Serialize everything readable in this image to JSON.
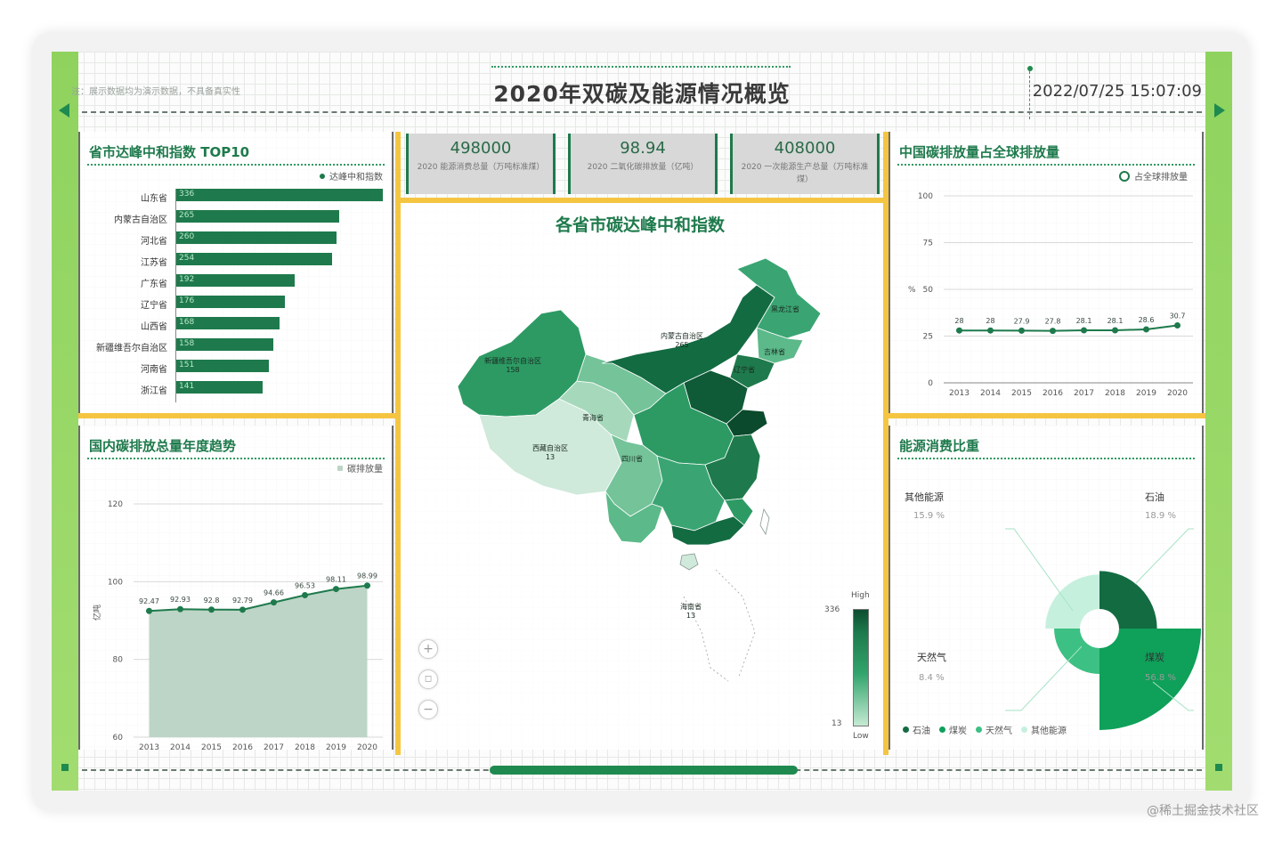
{
  "header": {
    "note": "注：展示数据均为演示数据，不具备真实性",
    "title": "2020年双碳及能源情况概览",
    "datetime": "2022/07/25 15:07:09"
  },
  "top10": {
    "title": "省市达峰中和指数 TOP10",
    "legend": "达峰中和指数",
    "items": [
      {
        "label": "山东省",
        "value": 336
      },
      {
        "label": "内蒙古自治区",
        "value": 265
      },
      {
        "label": "河北省",
        "value": 260
      },
      {
        "label": "江苏省",
        "value": 254
      },
      {
        "label": "广东省",
        "value": 192
      },
      {
        "label": "辽宁省",
        "value": 176
      },
      {
        "label": "山西省",
        "value": 168
      },
      {
        "label": "新疆维吾尔自治区",
        "value": 158
      },
      {
        "label": "河南省",
        "value": 151
      },
      {
        "label": "浙江省",
        "value": 141
      }
    ]
  },
  "kpis": [
    {
      "value": "498000",
      "label": "2020 能源消费总量（万吨标准煤）"
    },
    {
      "value": "98.94",
      "label": "2020 二氧化碳排放量（亿吨）"
    },
    {
      "value": "408000",
      "label": "2020 一次能源生产总量（万吨标准煤）"
    }
  ],
  "map": {
    "title": "各省市碳达峰中和指数",
    "visual_high": "High",
    "visual_low": "Low",
    "max_value": "336",
    "min_value": "13",
    "zoom_in": "+",
    "reset": "◻",
    "zoom_out": "−",
    "labels": [
      {
        "text": "新疆维吾尔自治区\n158"
      },
      {
        "text": "内蒙古自治区\n265"
      },
      {
        "text": "黑龙江省"
      },
      {
        "text": "吉林省"
      },
      {
        "text": "辽宁省"
      },
      {
        "text": "青海省"
      },
      {
        "text": "西藏自治区\n13"
      },
      {
        "text": "四川省"
      },
      {
        "text": "海南省\n13"
      }
    ]
  },
  "global_share": {
    "title": "中国碳排放量占全球排放量",
    "legend": "占全球排放量",
    "unit": "%",
    "y_ticks": [
      "100",
      "75",
      "50",
      "25",
      "0"
    ]
  },
  "trend": {
    "title": "国内碳排放总量年度趋势",
    "legend": "碳排放量",
    "unit": "亿吨",
    "y_ticks": [
      "120",
      "100",
      "80",
      "60"
    ]
  },
  "energy": {
    "title": "能源消费比重",
    "items": [
      {
        "label": "石油",
        "pct": "18.9 %"
      },
      {
        "label": "煤炭",
        "pct": "56.8 %"
      },
      {
        "label": "天然气",
        "pct": "8.4 %"
      },
      {
        "label": "其他能源",
        "pct": "15.9 %"
      }
    ]
  },
  "watermark": "@稀土掘金技术社区",
  "chart_data": [
    {
      "type": "bar",
      "title": "省市达峰中和指数 TOP10",
      "categories": [
        "山东省",
        "内蒙古自治区",
        "河北省",
        "江苏省",
        "广东省",
        "辽宁省",
        "山西省",
        "新疆维吾尔自治区",
        "河南省",
        "浙江省"
      ],
      "series": [
        {
          "name": "达峰中和指数",
          "values": [
            336,
            265,
            260,
            254,
            192,
            176,
            168,
            158,
            151,
            141
          ]
        }
      ],
      "orientation": "horizontal"
    },
    {
      "type": "line",
      "title": "中国碳排放量占全球排放量",
      "x": [
        "2013",
        "2014",
        "2015",
        "2016",
        "2017",
        "2018",
        "2019",
        "2020"
      ],
      "series": [
        {
          "name": "占全球排放量",
          "values": [
            28,
            28,
            27.9,
            27.8,
            28.1,
            28.1,
            28.6,
            30.7
          ]
        }
      ],
      "ylabel": "%",
      "ylim": [
        0,
        100
      ],
      "grid": true,
      "legend": "top-right"
    },
    {
      "type": "area",
      "title": "国内碳排放总量年度趋势",
      "x": [
        "2013",
        "2014",
        "2015",
        "2016",
        "2017",
        "2018",
        "2019",
        "2020"
      ],
      "series": [
        {
          "name": "碳排放量",
          "values": [
            92.47,
            92.93,
            92.8,
            92.79,
            94.66,
            96.53,
            98.11,
            98.99
          ]
        }
      ],
      "ylabel": "亿吨",
      "ylim": [
        60,
        120
      ],
      "grid": true,
      "legend": "top-right"
    },
    {
      "type": "pie",
      "title": "能源消费比重",
      "categories": [
        "石油",
        "煤炭",
        "天然气",
        "其他能源"
      ],
      "values": [
        18.9,
        56.8,
        8.4,
        15.9
      ],
      "variant": "rose",
      "legend": "bottom-left"
    }
  ]
}
